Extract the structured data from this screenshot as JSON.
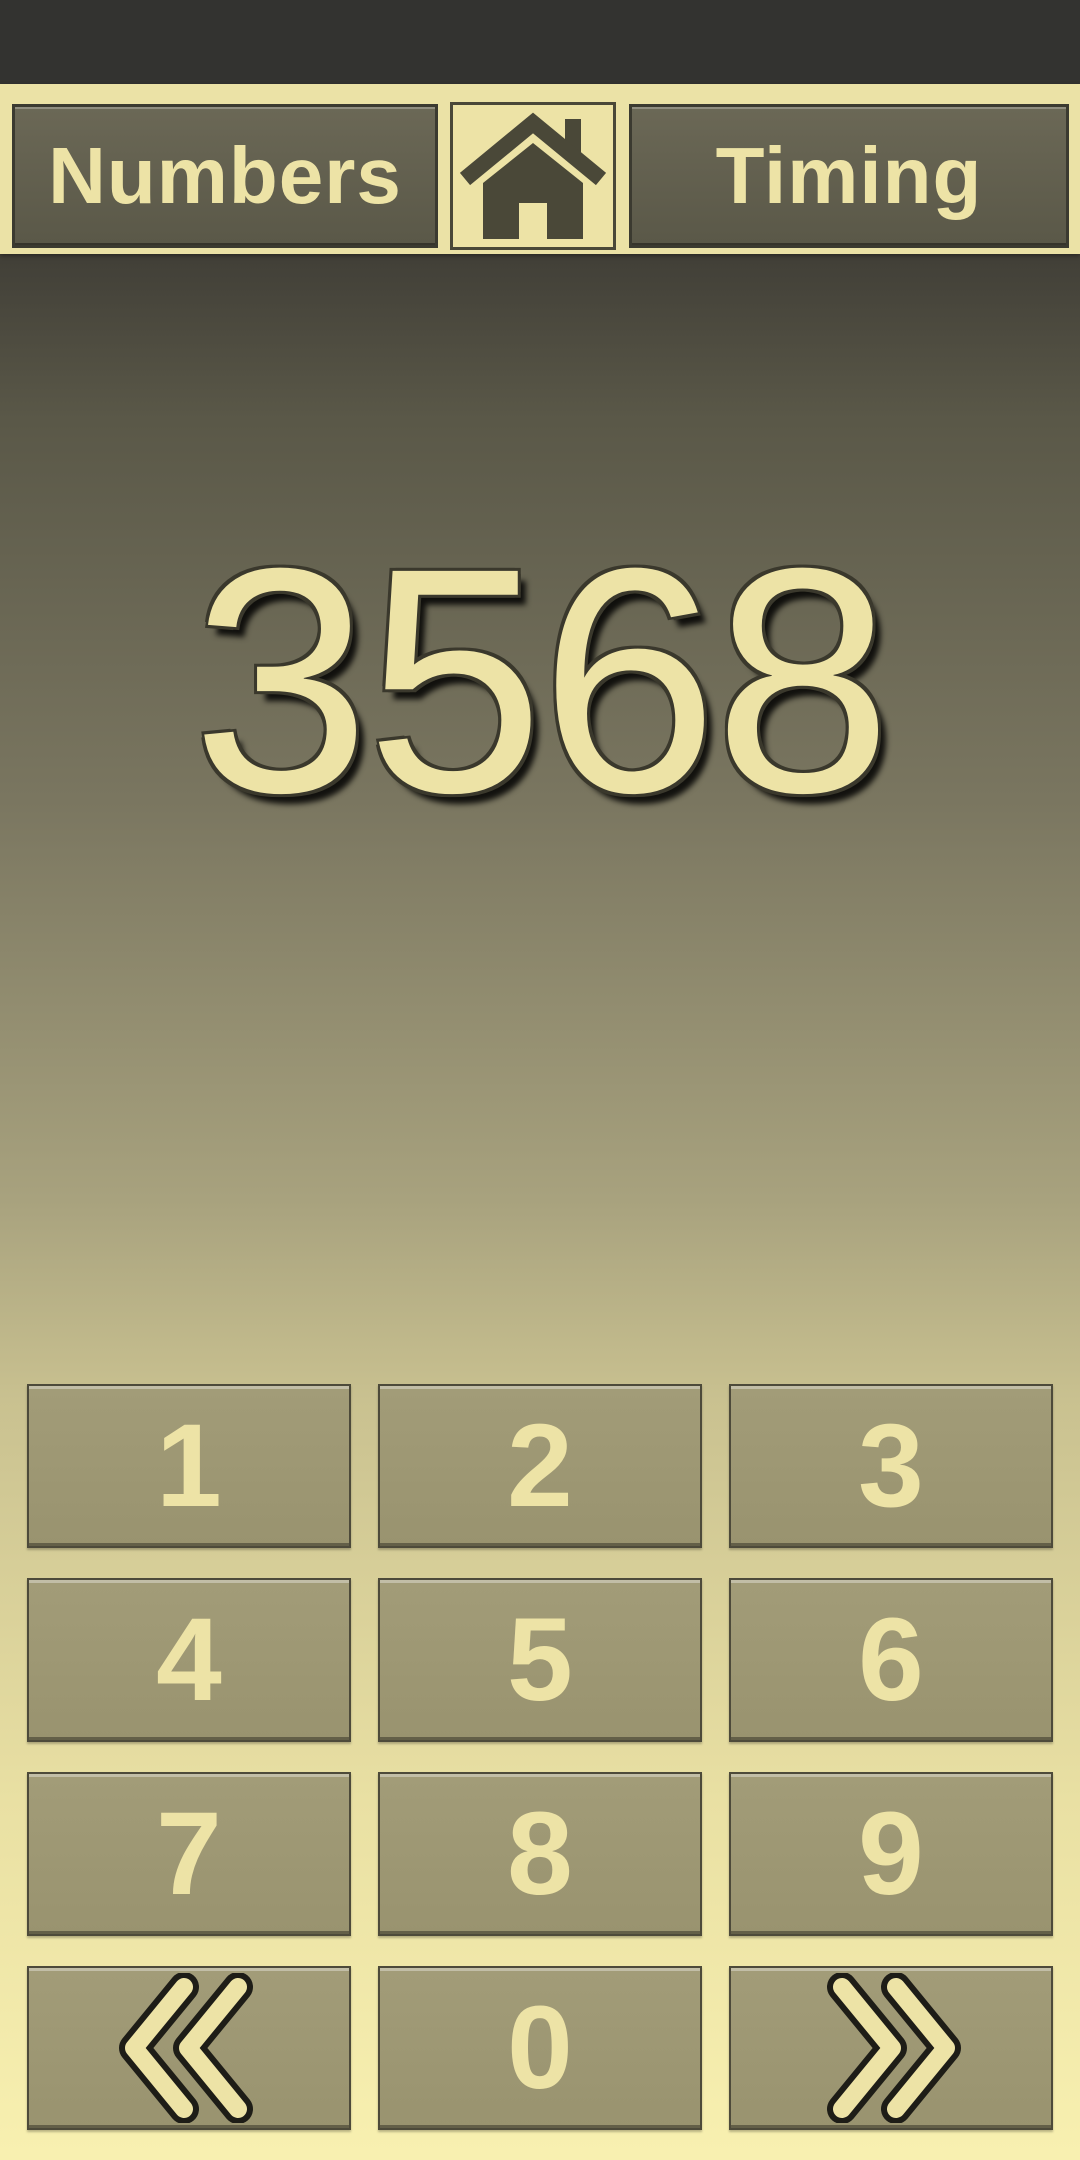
{
  "nav": {
    "left_label": "Numbers",
    "right_label": "Timing",
    "home_icon": "home-icon"
  },
  "display": {
    "number": "3568"
  },
  "keypad": {
    "keys": [
      {
        "label": "1"
      },
      {
        "label": "2"
      },
      {
        "label": "3"
      },
      {
        "label": "4"
      },
      {
        "label": "5"
      },
      {
        "label": "6"
      },
      {
        "label": "7"
      },
      {
        "label": "8"
      },
      {
        "label": "9"
      },
      {
        "icon": "double-chevron-left-icon"
      },
      {
        "label": "0"
      },
      {
        "icon": "double-chevron-right-icon"
      }
    ]
  },
  "colors": {
    "accent": "#ede3a6",
    "button_face": "#99936f",
    "dark_panel": "#5a5848"
  }
}
